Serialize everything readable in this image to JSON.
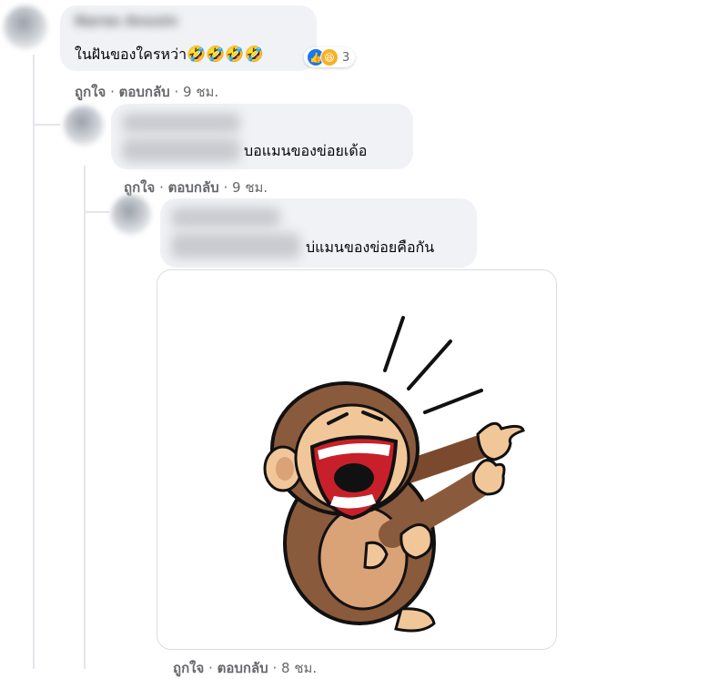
{
  "comments": [
    {
      "author": "Naree Anusin",
      "text": "ในฝันของใครหว่า",
      "emoji": "🤣🤣🤣🤣",
      "reactions": {
        "icons": [
          "like",
          "haha"
        ],
        "count": "3"
      },
      "actions": {
        "like": "ถูกใจ",
        "reply": "ตอบกลับ",
        "time": "9 ชม."
      }
    },
    {
      "author": "",
      "text": "บอแมนของข่อยเด้อ",
      "actions": {
        "like": "ถูกใจ",
        "reply": "ตอบกลับ",
        "time": "9 ชม."
      }
    },
    {
      "author": "",
      "text": "บ่แมนของข่อยคือกัน",
      "sticker": "laughing-monkey-sticker",
      "actions": {
        "like": "ถูกใจ",
        "reply": "ตอบกลับ",
        "time": "8 ชม."
      }
    }
  ],
  "separator": "·",
  "colors": {
    "bubble": "#f0f2f5",
    "meta": "#65676b",
    "like_blue": "#1877f2",
    "haha_yellow": "#f7b125",
    "monkey_brown": "#8a5a3c"
  }
}
